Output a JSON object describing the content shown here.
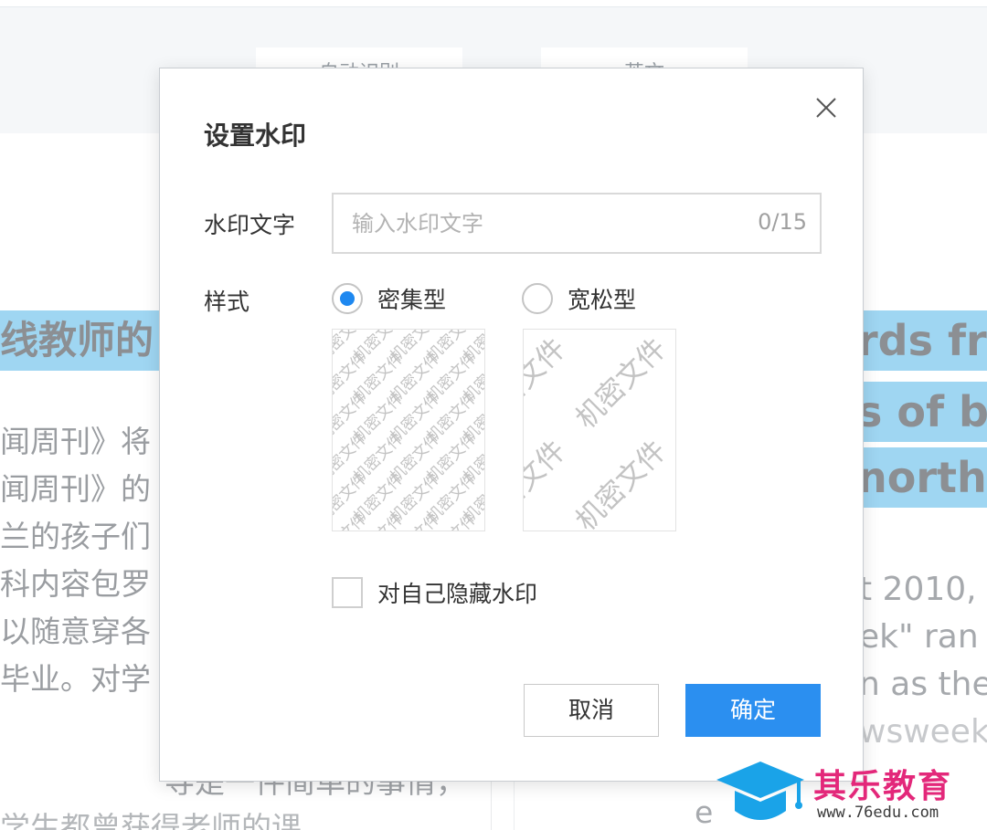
{
  "background": {
    "steps": [
      "自动识别",
      "英文"
    ],
    "step_arrow": "→",
    "left_title": "线教师的",
    "left_lines": [
      "闻周刊》将",
      "闻周刊》的",
      "兰的孩子们",
      "科内容包罗",
      "以随意穿各",
      "毕业。对学"
    ],
    "left_bottom": "导是一件简单的事情，",
    "left_bottom2": "学生都曾获得老师的课",
    "right_titles": [
      "rds fro",
      "s of b",
      "northe"
    ],
    "right_lines": [
      "t 2010,",
      "ek\" ran",
      "n as the",
      "wsweek"
    ],
    "right_bottom": "e"
  },
  "dialog": {
    "title": "设置水印",
    "close_icon": "close-icon",
    "text_label": "水印文字",
    "text_input": {
      "value": "",
      "placeholder": "输入水印文字",
      "counter": "0/15"
    },
    "style_label": "样式",
    "style_options": [
      {
        "label": "密集型",
        "checked": true
      },
      {
        "label": "宽松型",
        "checked": false
      }
    ],
    "preview_text": "机密文件",
    "hide_self_label": "对自己隐藏水印",
    "hide_self_checked": false,
    "cancel_label": "取消",
    "ok_label": "确定",
    "accent_color": "#2b8ff0"
  },
  "logo": {
    "name": "其乐教育",
    "url": "www.76edu.com",
    "icon": "graduation-cap-icon",
    "color_primary": "#e3287a",
    "color_icon": "#1aa3e8"
  }
}
